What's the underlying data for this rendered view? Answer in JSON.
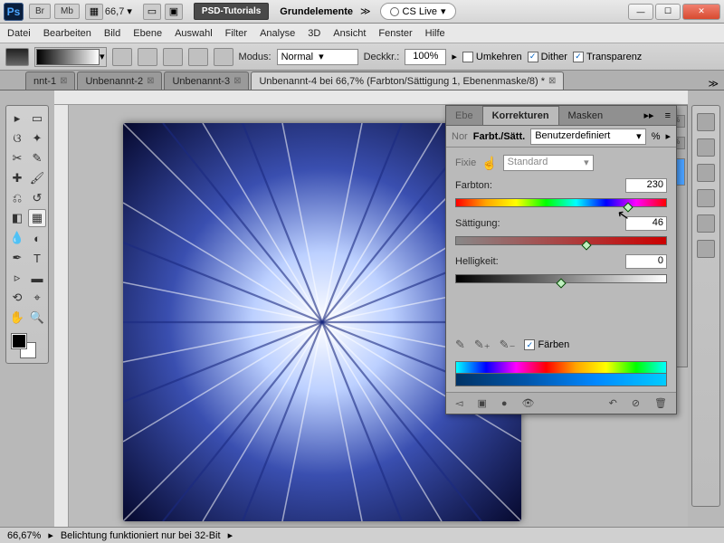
{
  "title": {
    "zoom": "66,7",
    "psdTutorials": "PSD-Tutorials",
    "grundelemente": "Grundelemente",
    "cslive": "CS Live"
  },
  "menu": [
    "Datei",
    "Bearbeiten",
    "Bild",
    "Ebene",
    "Auswahl",
    "Filter",
    "Analyse",
    "3D",
    "Ansicht",
    "Fenster",
    "Hilfe"
  ],
  "optbar": {
    "modus": "Modus:",
    "modusVal": "Normal",
    "deckkr": "Deckkr.:",
    "deckkrVal": "100%",
    "umkehren": "Umkehren",
    "dither": "Dither",
    "transparenz": "Transparenz"
  },
  "tabs": [
    {
      "label": "nnt-1",
      "active": false
    },
    {
      "label": "Unbenannt-2",
      "active": false
    },
    {
      "label": "Unbenannt-3",
      "active": false
    },
    {
      "label": "Unbenannt-4 bei 66,7% (Farbton/Sättigung 1, Ebenenmaske/8) *",
      "active": true
    }
  ],
  "panel": {
    "tabs": {
      "ebe": "Ebe",
      "korrekturen": "Korrekturen",
      "masken": "Masken"
    },
    "header": {
      "nor": "Nor",
      "title": "Farbt./Sätt.",
      "preset": "Benutzerdefiniert",
      "pct": "%"
    },
    "fixie": "Fixie",
    "standard": "Standard",
    "farbton": {
      "label": "Farbton:",
      "value": "230",
      "pos": 82
    },
    "saettigung": {
      "label": "Sättigung:",
      "value": "46",
      "pos": 62
    },
    "helligkeit": {
      "label": "Helligkeit:",
      "value": "0",
      "pos": 50
    },
    "faerben": "Färben"
  },
  "status": {
    "zoom": "66,67%",
    "msg": "Belichtung funktioniert nur bei 32-Bit"
  }
}
